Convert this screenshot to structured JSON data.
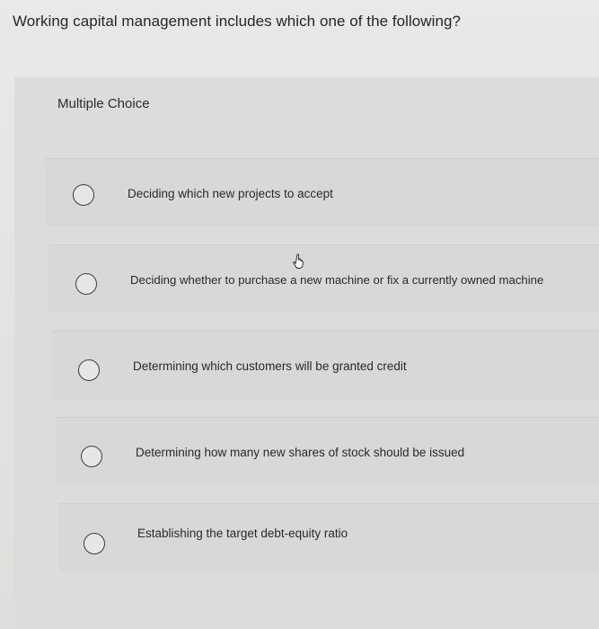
{
  "question": {
    "text": "Working capital management includes which one of the following?"
  },
  "section_label": "Multiple Choice",
  "choices": [
    {
      "label": "Deciding which new projects to accept"
    },
    {
      "label": "Deciding whether to purchase a new machine or fix a currently owned machine"
    },
    {
      "label": "Determining which customers will be granted credit"
    },
    {
      "label": "Determining how many new shares of stock should be issued"
    },
    {
      "label": "Establishing the target debt-equity ratio"
    }
  ],
  "cursor": {
    "icon": "hand-pointer-icon"
  }
}
